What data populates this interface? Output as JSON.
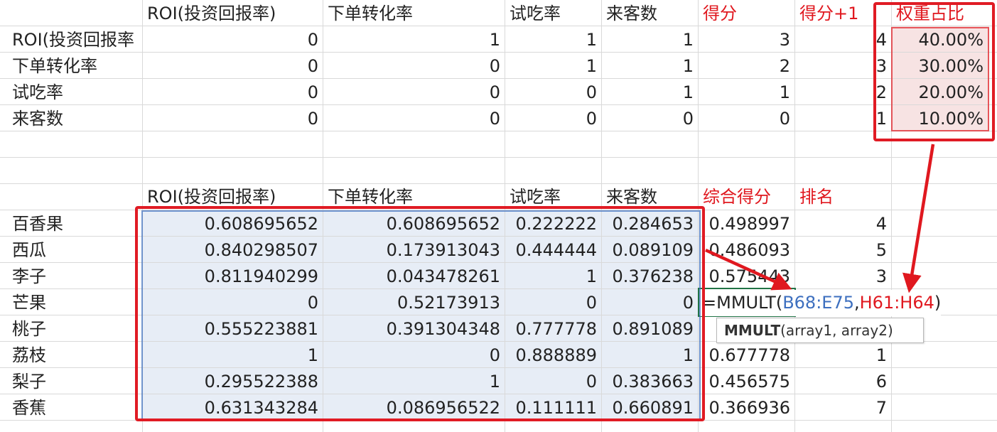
{
  "top_table": {
    "headers": {
      "c1": "ROI(投资回报率)",
      "c2": "下单转化率",
      "c3": "试吃率",
      "c4": "来客数",
      "score": "得分",
      "score_plus1": "得分+1",
      "weight": "权重占比"
    },
    "rows": [
      {
        "label": "ROI(投资回报率",
        "v1": "0",
        "v2": "1",
        "v3": "1",
        "v4": "1",
        "score": "3",
        "score_plus1": "4",
        "weight": "40.00%"
      },
      {
        "label": "下单转化率",
        "v1": "0",
        "v2": "0",
        "v3": "1",
        "v4": "1",
        "score": "2",
        "score_plus1": "3",
        "weight": "30.00%"
      },
      {
        "label": "试吃率",
        "v1": "0",
        "v2": "0",
        "v3": "0",
        "v4": "1",
        "score": "1",
        "score_plus1": "2",
        "weight": "20.00%"
      },
      {
        "label": "来客数",
        "v1": "0",
        "v2": "0",
        "v3": "0",
        "v4": "0",
        "score": "0",
        "score_plus1": "1",
        "weight": "10.00%"
      }
    ]
  },
  "bottom_table": {
    "headers": {
      "c1": "ROI(投资回报率)",
      "c2": "下单转化率",
      "c3": "试吃率",
      "c4": "来客数",
      "composite": "综合得分",
      "rank": "排名"
    },
    "rows": [
      {
        "label": "百香果",
        "v1": "0.608695652",
        "v2": "0.608695652",
        "v3": "0.222222",
        "v4": "0.284653",
        "composite": "0.498997",
        "rank": "4"
      },
      {
        "label": "西瓜",
        "v1": "0.840298507",
        "v2": "0.173913043",
        "v3": "0.444444",
        "v4": "0.089109",
        "composite": "0.486093",
        "rank": "5"
      },
      {
        "label": "李子",
        "v1": "0.811940299",
        "v2": "0.043478261",
        "v3": "1",
        "v4": "0.376238",
        "composite": "0.575443",
        "rank": "3"
      },
      {
        "label": "芒果",
        "v1": "0",
        "v2": "0.52173913",
        "v3": "0",
        "v4": "0",
        "composite": "",
        "rank": ""
      },
      {
        "label": "桃子",
        "v1": "0.555223881",
        "v2": "0.391304348",
        "v3": "0.777778",
        "v4": "0.891089",
        "composite": "",
        "rank": ""
      },
      {
        "label": "荔枝",
        "v1": "1",
        "v2": "0",
        "v3": "0.888889",
        "v4": "1",
        "composite": "0.677778",
        "rank": "1"
      },
      {
        "label": "梨子",
        "v1": "0.295522388",
        "v2": "1",
        "v3": "0",
        "v4": "0.383663",
        "composite": "0.456575",
        "rank": "6"
      },
      {
        "label": "香蕉",
        "v1": "0.631343284",
        "v2": "0.086956522",
        "v3": "0.111111",
        "v4": "0.660891",
        "composite": "0.366936",
        "rank": "7"
      }
    ]
  },
  "formula": {
    "prefix": "=MMULT(",
    "ref1": "B68:E75",
    "sep": ",",
    "ref2": "H61:H64",
    "suffix": ")"
  },
  "tooltip": {
    "func": "MMULT",
    "args": "(array1, array2)"
  },
  "colors": {
    "accent_red": "#e0181f",
    "highlight_blue": "#e7edf6",
    "highlight_pink": "#f7e3e3",
    "ref_blue": "#3d6fbf"
  }
}
